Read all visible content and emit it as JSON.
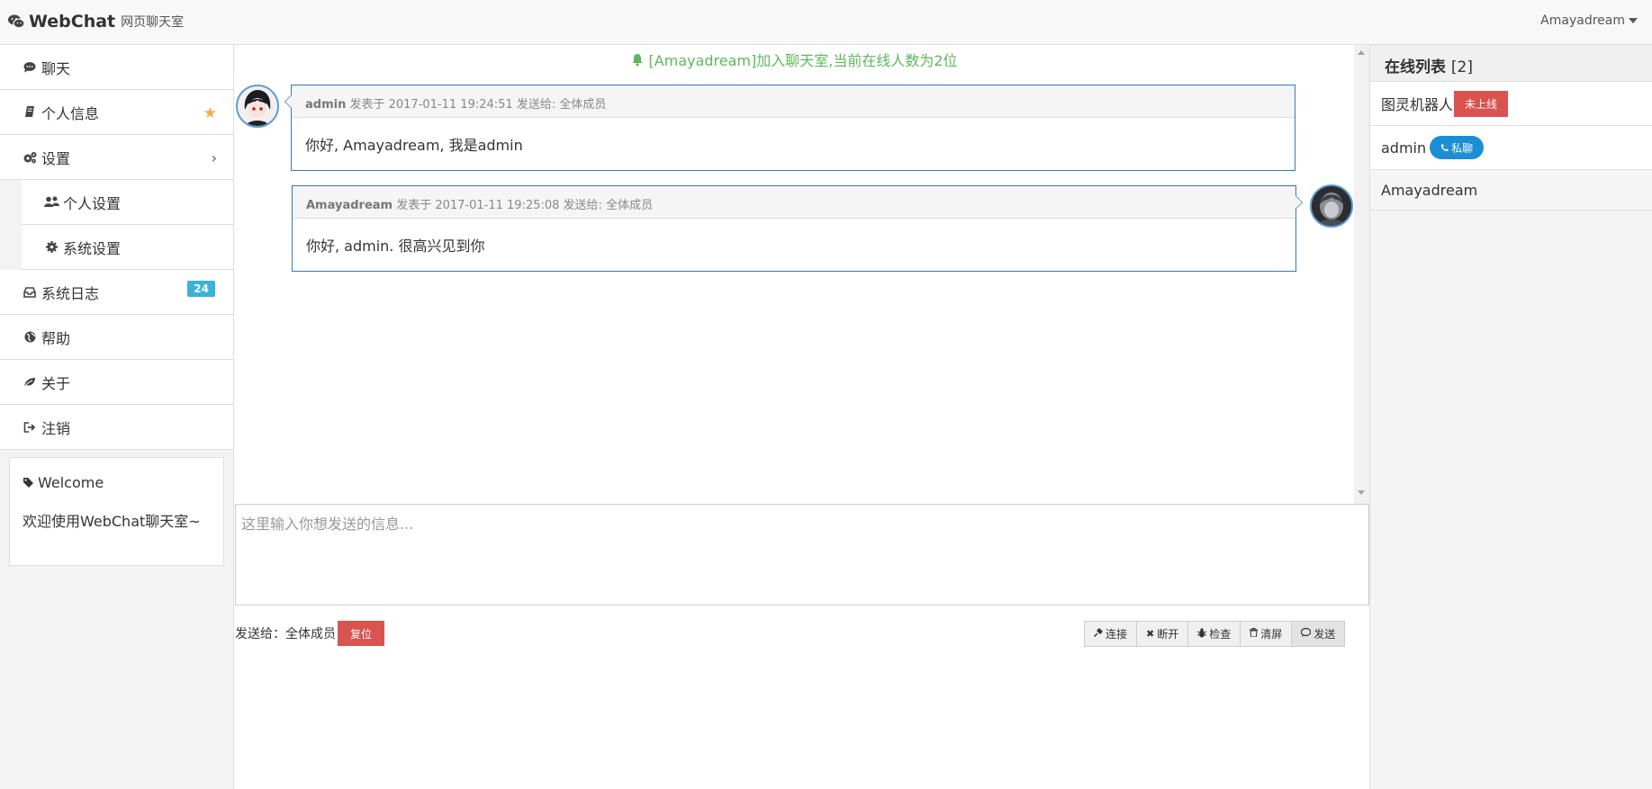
{
  "header": {
    "brand": "WebChat",
    "brand_sub": "网页聊天室",
    "user": "Amayadream"
  },
  "sidebar": {
    "items": [
      {
        "label": "聊天",
        "icon": "comment-icon"
      },
      {
        "label": "个人信息",
        "icon": "book-icon"
      },
      {
        "label": "设置",
        "icon": "cogs-icon"
      },
      {
        "label": "个人设置",
        "icon": "users-icon"
      },
      {
        "label": "系统设置",
        "icon": "gear-icon"
      },
      {
        "label": "系统日志",
        "icon": "inbox-icon",
        "badge": "24"
      },
      {
        "label": "帮助",
        "icon": "globe-icon"
      },
      {
        "label": "关于",
        "icon": "leaf-icon"
      },
      {
        "label": "注销",
        "icon": "sign-out-icon"
      }
    ],
    "welcome": {
      "title": "Welcome",
      "body": "欢迎使用WebChat聊天室~"
    }
  },
  "chat": {
    "notice": "[Amayadream]加入聊天室,当前在线人数为2位",
    "messages": [
      {
        "sender": "admin",
        "meta": "发表于 2017-01-11 19:24:51 发送给: 全体成员",
        "text": "你好, Amayadream, 我是admin"
      },
      {
        "sender": "Amayadream",
        "meta": "发表于 2017-01-11 19:25:08 发送给: 全体成员",
        "text": "你好, admin. 很高兴见到你"
      }
    ]
  },
  "composer": {
    "placeholder": "这里输入你想发送的信息...",
    "send_to_label": "发送给：全体成员",
    "reset_label": "复位",
    "buttons": [
      "连接",
      "断开",
      "检查",
      "清屏",
      "发送"
    ]
  },
  "online": {
    "title": "在线列表",
    "count": "[2]",
    "users": [
      {
        "name": "图灵机器人",
        "tag": "未上线"
      },
      {
        "name": "admin",
        "tag": "私聊"
      },
      {
        "name": "Amayadream"
      }
    ]
  },
  "colors": {
    "accent_blue": "#337ab7",
    "success_green": "#5cb85c",
    "danger_red": "#d9534f",
    "info_blue": "#39b3d7",
    "star_orange": "#f0ad4e"
  }
}
